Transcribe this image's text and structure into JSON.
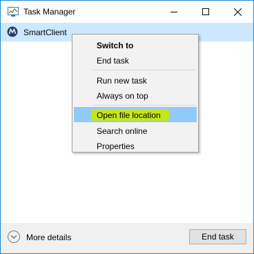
{
  "window": {
    "title": "Task Manager",
    "accent_color": "#1883d7"
  },
  "titlebar_buttons": {
    "minimize_icon": "minimize-icon",
    "maximize_icon": "maximize-icon",
    "close_icon": "close-icon"
  },
  "processes": [
    {
      "name": "SmartClient",
      "icon": "smartclient-icon",
      "selected": true
    }
  ],
  "context_menu": {
    "items": [
      {
        "label": "Switch to",
        "bold": true
      },
      {
        "label": "End task"
      },
      {
        "label": "Run new task"
      },
      {
        "label": "Always on top"
      },
      {
        "label": "Open file location",
        "highlighted": true,
        "marker_color": "#c6e61b"
      },
      {
        "label": "Search online"
      },
      {
        "label": "Properties"
      }
    ]
  },
  "footer": {
    "more_details_label": "More details",
    "end_task_label": "End task"
  },
  "colors": {
    "selected_row": "#cce8ff",
    "menu_highlight": "#91c9f7",
    "footer_bg": "#f0f0f0"
  }
}
